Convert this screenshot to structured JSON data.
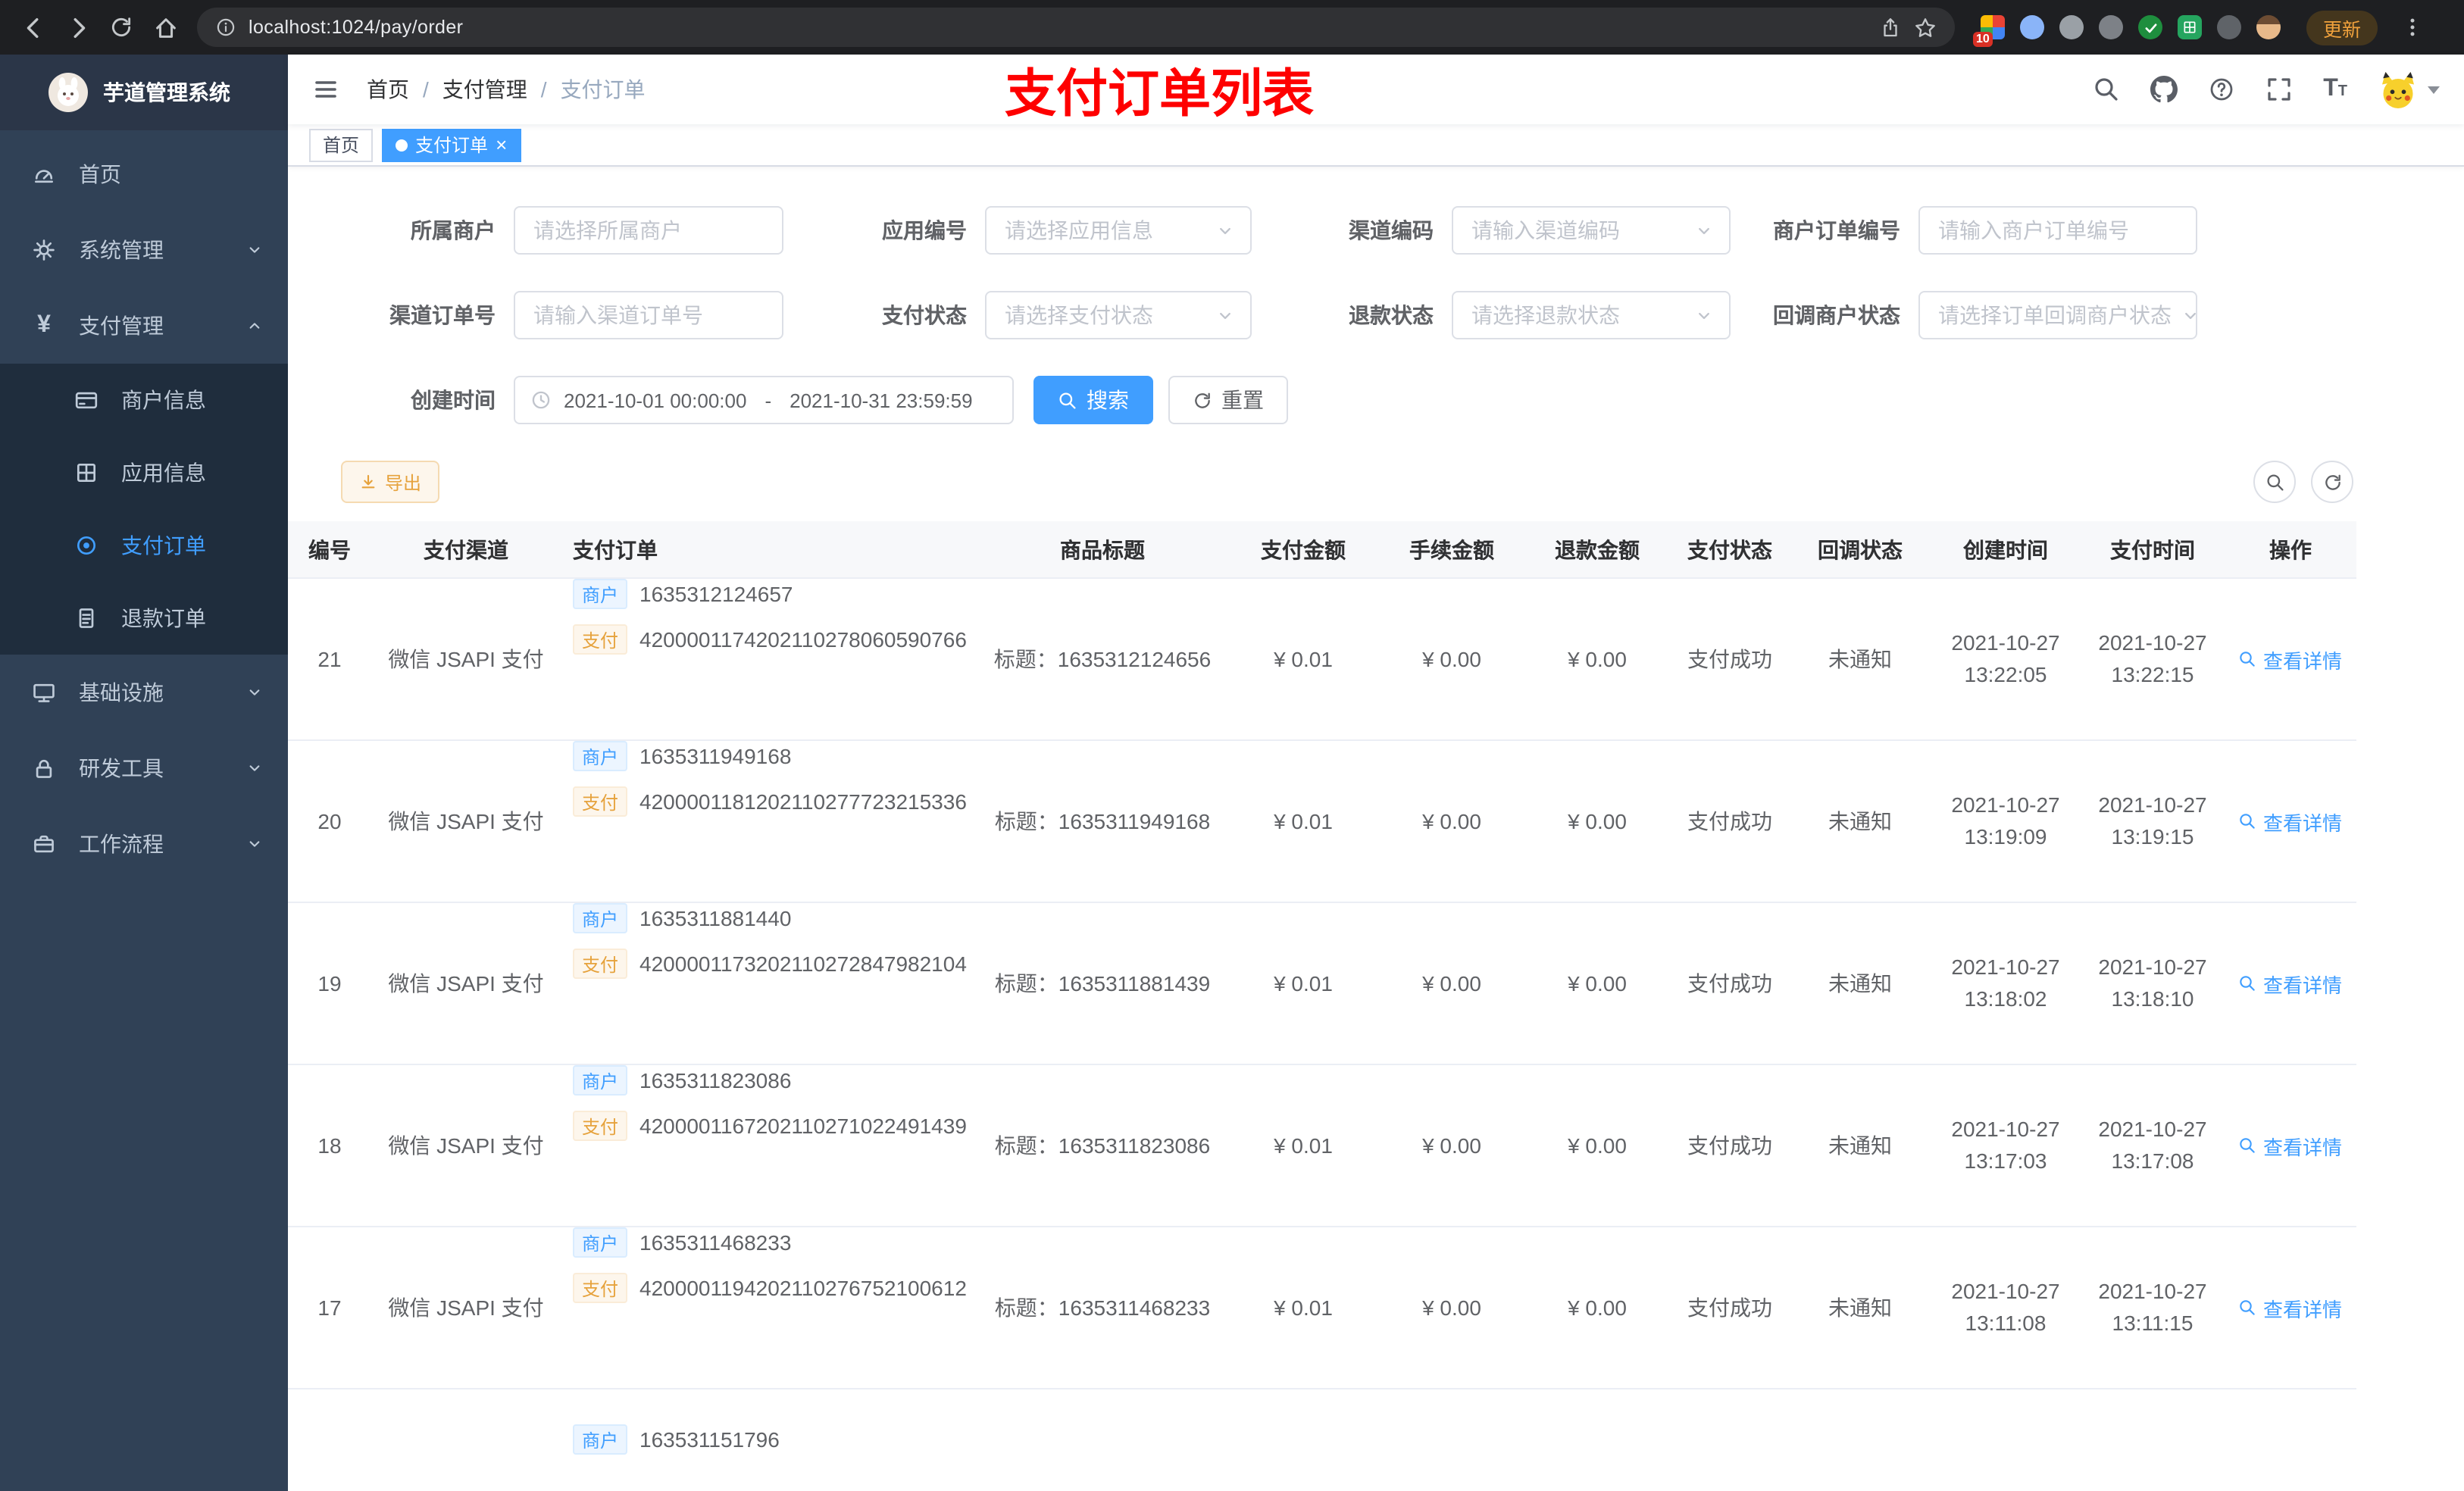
{
  "colors": {
    "accent": "#409eff",
    "warning": "#e6a23c",
    "annotation_red": "#fe0000"
  },
  "browser": {
    "url": "localhost:1024/pay/order",
    "update_label": "更新",
    "extension_badge": "10"
  },
  "sidebar": {
    "logo_title": "芋道管理系统",
    "menu": {
      "home": "首页",
      "system": "系统管理",
      "payment": "支付管理",
      "merchant_info": "商户信息",
      "app_info": "应用信息",
      "pay_order": "支付订单",
      "refund_order": "退款订单",
      "infra": "基础设施",
      "dev_tools": "研发工具",
      "workflow": "工作流程"
    }
  },
  "navbar": {
    "breadcrumb": {
      "home": "首页",
      "sep1": "/",
      "payment": "支付管理",
      "sep2": "/",
      "current": "支付订单"
    },
    "annotation": "支付订单列表"
  },
  "tags": {
    "home": "首页",
    "current": "支付订单",
    "close": "×"
  },
  "filters": {
    "merchant": {
      "label": "所属商户",
      "placeholder": "请选择所属商户"
    },
    "app": {
      "label": "应用编号",
      "placeholder": "请选择应用信息"
    },
    "channel_code": {
      "label": "渠道编码",
      "placeholder": "请输入渠道编码"
    },
    "merchant_order_no": {
      "label": "商户订单编号",
      "placeholder": "请输入商户订单编号"
    },
    "channel_order_no": {
      "label": "渠道订单号",
      "placeholder": "请输入渠道订单号"
    },
    "pay_status": {
      "label": "支付状态",
      "placeholder": "请选择支付状态"
    },
    "refund_status": {
      "label": "退款状态",
      "placeholder": "请选择退款状态"
    },
    "notify_status": {
      "label": "回调商户状态",
      "placeholder": "请选择订单回调商户状态"
    },
    "create_time": {
      "label": "创建时间",
      "start": "2021-10-01 00:00:00",
      "separator": "-",
      "end": "2021-10-31 23:59:59"
    },
    "search": "搜索",
    "reset": "重置"
  },
  "toolbar": {
    "export": "导出"
  },
  "table": {
    "headers": [
      "编号",
      "支付渠道",
      "支付订单",
      "商品标题",
      "支付金额",
      "手续金额",
      "退款金额",
      "支付状态",
      "回调状态",
      "创建时间",
      "支付时间",
      "操作"
    ],
    "tags": {
      "merchant": "商户",
      "pay": "支付"
    },
    "action": "查看详情",
    "rows": [
      {
        "id": "21",
        "channel": "微信 JSAPI 支付",
        "merchant_no": "1635312124657",
        "pay_no": "4200001174202110278060590766",
        "title": "标题：1635312124656",
        "amount": "¥ 0.01",
        "fee": "¥ 0.00",
        "refund": "¥ 0.00",
        "status": "支付成功",
        "notify": "未通知",
        "create_date": "2021-10-27",
        "create_time": "13:22:05",
        "pay_date": "2021-10-27",
        "pay_time": "13:22:15"
      },
      {
        "id": "20",
        "channel": "微信 JSAPI 支付",
        "merchant_no": "1635311949168",
        "pay_no": "4200001181202110277723215336",
        "title": "标题：1635311949168",
        "amount": "¥ 0.01",
        "fee": "¥ 0.00",
        "refund": "¥ 0.00",
        "status": "支付成功",
        "notify": "未通知",
        "create_date": "2021-10-27",
        "create_time": "13:19:09",
        "pay_date": "2021-10-27",
        "pay_time": "13:19:15"
      },
      {
        "id": "19",
        "channel": "微信 JSAPI 支付",
        "merchant_no": "1635311881440",
        "pay_no": "4200001173202110272847982104",
        "title": "标题：1635311881439",
        "amount": "¥ 0.01",
        "fee": "¥ 0.00",
        "refund": "¥ 0.00",
        "status": "支付成功",
        "notify": "未通知",
        "create_date": "2021-10-27",
        "create_time": "13:18:02",
        "pay_date": "2021-10-27",
        "pay_time": "13:18:10"
      },
      {
        "id": "18",
        "channel": "微信 JSAPI 支付",
        "merchant_no": "1635311823086",
        "pay_no": "4200001167202110271022491439",
        "title": "标题：1635311823086",
        "amount": "¥ 0.01",
        "fee": "¥ 0.00",
        "refund": "¥ 0.00",
        "status": "支付成功",
        "notify": "未通知",
        "create_date": "2021-10-27",
        "create_time": "13:17:03",
        "pay_date": "2021-10-27",
        "pay_time": "13:17:08"
      },
      {
        "id": "17",
        "channel": "微信 JSAPI 支付",
        "merchant_no": "1635311468233",
        "pay_no": "4200001194202110276752100612",
        "title": "标题：1635311468233",
        "amount": "¥ 0.01",
        "fee": "¥ 0.00",
        "refund": "¥ 0.00",
        "status": "支付成功",
        "notify": "未通知",
        "create_date": "2021-10-27",
        "create_time": "13:11:08",
        "pay_date": "2021-10-27",
        "pay_time": "13:11:15"
      }
    ],
    "partial_row": {
      "merchant_no": "163531151796"
    }
  }
}
